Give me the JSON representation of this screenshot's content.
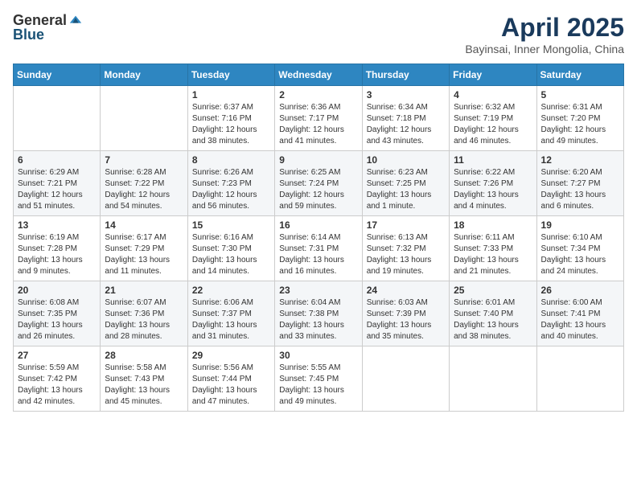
{
  "logo": {
    "general": "General",
    "blue": "Blue"
  },
  "header": {
    "month": "April 2025",
    "location": "Bayinsai, Inner Mongolia, China"
  },
  "weekdays": [
    "Sunday",
    "Monday",
    "Tuesday",
    "Wednesday",
    "Thursday",
    "Friday",
    "Saturday"
  ],
  "weeks": [
    [
      {
        "day": "",
        "sunrise": "",
        "sunset": "",
        "daylight": ""
      },
      {
        "day": "",
        "sunrise": "",
        "sunset": "",
        "daylight": ""
      },
      {
        "day": "1",
        "sunrise": "Sunrise: 6:37 AM",
        "sunset": "Sunset: 7:16 PM",
        "daylight": "Daylight: 12 hours and 38 minutes."
      },
      {
        "day": "2",
        "sunrise": "Sunrise: 6:36 AM",
        "sunset": "Sunset: 7:17 PM",
        "daylight": "Daylight: 12 hours and 41 minutes."
      },
      {
        "day": "3",
        "sunrise": "Sunrise: 6:34 AM",
        "sunset": "Sunset: 7:18 PM",
        "daylight": "Daylight: 12 hours and 43 minutes."
      },
      {
        "day": "4",
        "sunrise": "Sunrise: 6:32 AM",
        "sunset": "Sunset: 7:19 PM",
        "daylight": "Daylight: 12 hours and 46 minutes."
      },
      {
        "day": "5",
        "sunrise": "Sunrise: 6:31 AM",
        "sunset": "Sunset: 7:20 PM",
        "daylight": "Daylight: 12 hours and 49 minutes."
      }
    ],
    [
      {
        "day": "6",
        "sunrise": "Sunrise: 6:29 AM",
        "sunset": "Sunset: 7:21 PM",
        "daylight": "Daylight: 12 hours and 51 minutes."
      },
      {
        "day": "7",
        "sunrise": "Sunrise: 6:28 AM",
        "sunset": "Sunset: 7:22 PM",
        "daylight": "Daylight: 12 hours and 54 minutes."
      },
      {
        "day": "8",
        "sunrise": "Sunrise: 6:26 AM",
        "sunset": "Sunset: 7:23 PM",
        "daylight": "Daylight: 12 hours and 56 minutes."
      },
      {
        "day": "9",
        "sunrise": "Sunrise: 6:25 AM",
        "sunset": "Sunset: 7:24 PM",
        "daylight": "Daylight: 12 hours and 59 minutes."
      },
      {
        "day": "10",
        "sunrise": "Sunrise: 6:23 AM",
        "sunset": "Sunset: 7:25 PM",
        "daylight": "Daylight: 13 hours and 1 minute."
      },
      {
        "day": "11",
        "sunrise": "Sunrise: 6:22 AM",
        "sunset": "Sunset: 7:26 PM",
        "daylight": "Daylight: 13 hours and 4 minutes."
      },
      {
        "day": "12",
        "sunrise": "Sunrise: 6:20 AM",
        "sunset": "Sunset: 7:27 PM",
        "daylight": "Daylight: 13 hours and 6 minutes."
      }
    ],
    [
      {
        "day": "13",
        "sunrise": "Sunrise: 6:19 AM",
        "sunset": "Sunset: 7:28 PM",
        "daylight": "Daylight: 13 hours and 9 minutes."
      },
      {
        "day": "14",
        "sunrise": "Sunrise: 6:17 AM",
        "sunset": "Sunset: 7:29 PM",
        "daylight": "Daylight: 13 hours and 11 minutes."
      },
      {
        "day": "15",
        "sunrise": "Sunrise: 6:16 AM",
        "sunset": "Sunset: 7:30 PM",
        "daylight": "Daylight: 13 hours and 14 minutes."
      },
      {
        "day": "16",
        "sunrise": "Sunrise: 6:14 AM",
        "sunset": "Sunset: 7:31 PM",
        "daylight": "Daylight: 13 hours and 16 minutes."
      },
      {
        "day": "17",
        "sunrise": "Sunrise: 6:13 AM",
        "sunset": "Sunset: 7:32 PM",
        "daylight": "Daylight: 13 hours and 19 minutes."
      },
      {
        "day": "18",
        "sunrise": "Sunrise: 6:11 AM",
        "sunset": "Sunset: 7:33 PM",
        "daylight": "Daylight: 13 hours and 21 minutes."
      },
      {
        "day": "19",
        "sunrise": "Sunrise: 6:10 AM",
        "sunset": "Sunset: 7:34 PM",
        "daylight": "Daylight: 13 hours and 24 minutes."
      }
    ],
    [
      {
        "day": "20",
        "sunrise": "Sunrise: 6:08 AM",
        "sunset": "Sunset: 7:35 PM",
        "daylight": "Daylight: 13 hours and 26 minutes."
      },
      {
        "day": "21",
        "sunrise": "Sunrise: 6:07 AM",
        "sunset": "Sunset: 7:36 PM",
        "daylight": "Daylight: 13 hours and 28 minutes."
      },
      {
        "day": "22",
        "sunrise": "Sunrise: 6:06 AM",
        "sunset": "Sunset: 7:37 PM",
        "daylight": "Daylight: 13 hours and 31 minutes."
      },
      {
        "day": "23",
        "sunrise": "Sunrise: 6:04 AM",
        "sunset": "Sunset: 7:38 PM",
        "daylight": "Daylight: 13 hours and 33 minutes."
      },
      {
        "day": "24",
        "sunrise": "Sunrise: 6:03 AM",
        "sunset": "Sunset: 7:39 PM",
        "daylight": "Daylight: 13 hours and 35 minutes."
      },
      {
        "day": "25",
        "sunrise": "Sunrise: 6:01 AM",
        "sunset": "Sunset: 7:40 PM",
        "daylight": "Daylight: 13 hours and 38 minutes."
      },
      {
        "day": "26",
        "sunrise": "Sunrise: 6:00 AM",
        "sunset": "Sunset: 7:41 PM",
        "daylight": "Daylight: 13 hours and 40 minutes."
      }
    ],
    [
      {
        "day": "27",
        "sunrise": "Sunrise: 5:59 AM",
        "sunset": "Sunset: 7:42 PM",
        "daylight": "Daylight: 13 hours and 42 minutes."
      },
      {
        "day": "28",
        "sunrise": "Sunrise: 5:58 AM",
        "sunset": "Sunset: 7:43 PM",
        "daylight": "Daylight: 13 hours and 45 minutes."
      },
      {
        "day": "29",
        "sunrise": "Sunrise: 5:56 AM",
        "sunset": "Sunset: 7:44 PM",
        "daylight": "Daylight: 13 hours and 47 minutes."
      },
      {
        "day": "30",
        "sunrise": "Sunrise: 5:55 AM",
        "sunset": "Sunset: 7:45 PM",
        "daylight": "Daylight: 13 hours and 49 minutes."
      },
      {
        "day": "",
        "sunrise": "",
        "sunset": "",
        "daylight": ""
      },
      {
        "day": "",
        "sunrise": "",
        "sunset": "",
        "daylight": ""
      },
      {
        "day": "",
        "sunrise": "",
        "sunset": "",
        "daylight": ""
      }
    ]
  ]
}
